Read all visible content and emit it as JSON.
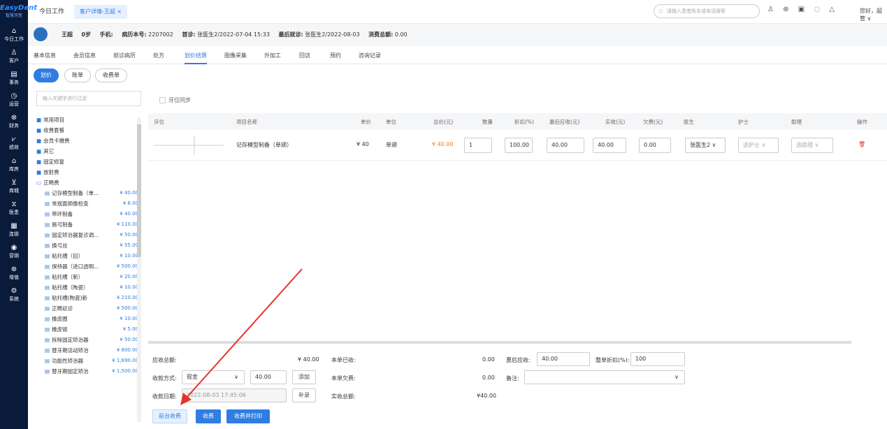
{
  "brand": {
    "name": "EasyDent",
    "sub": "智慧牙医"
  },
  "nav": [
    {
      "icon": "⌂",
      "label": "今日工作"
    },
    {
      "icon": "♙",
      "label": "客户"
    },
    {
      "icon": "▤",
      "label": "事务"
    },
    {
      "icon": "◷",
      "label": "运营"
    },
    {
      "icon": "⊗",
      "label": "财务"
    },
    {
      "icon": "⩗",
      "label": "绩效"
    },
    {
      "icon": "⌂",
      "label": "库房"
    },
    {
      "icon": "⊻",
      "label": "商城"
    },
    {
      "icon": "⧖",
      "label": "医患"
    },
    {
      "icon": "▦",
      "label": "连锁"
    },
    {
      "icon": "◉",
      "label": "营销"
    },
    {
      "icon": "⊕",
      "label": "增值"
    },
    {
      "icon": "⚙",
      "label": "系统"
    }
  ],
  "topbar": {
    "tab_today": "今日工作",
    "tab_active": "客户详情-王超 ×",
    "search_placeholder": "请输入患者姓名或电话搜索",
    "greeting": "您好，超管 ∨"
  },
  "patient": {
    "name": "王超",
    "age": "0岁",
    "phone_label": "手机:",
    "record_label": "病历本号:",
    "record_value": "2207002",
    "first_label": "首诊:",
    "first_value": "张医生2/2022-07-04 15:33",
    "last_label": "最后就诊:",
    "last_value": "张医生2/2022-08-03",
    "total_label": "消费总额:",
    "total_value": "0.00"
  },
  "tabs": [
    "基本信息",
    "会员信息",
    "就诊病历",
    "处方",
    "划价结算",
    "图像采集",
    "外加工",
    "回访",
    "预约",
    "咨询记录"
  ],
  "sub_tabs": [
    "划价",
    "账单",
    "收费单"
  ],
  "filter_placeholder": "输入关键字进行过滤",
  "tree": [
    {
      "label": "常用项目",
      "folder": true
    },
    {
      "label": "收费套餐",
      "folder": true
    },
    {
      "label": "会员卡缴费",
      "folder": true
    },
    {
      "label": "其它",
      "folder": true
    },
    {
      "label": "固定修复",
      "folder": true
    },
    {
      "label": "放射费",
      "folder": true
    },
    {
      "label": "正畸费",
      "folder": true,
      "open": true
    },
    {
      "label": "记存模型制备（单...",
      "price": "¥ 40.00"
    },
    {
      "label": "常规面颌像检查",
      "price": "¥ 8.00"
    },
    {
      "label": "带环制备",
      "price": "¥ 40.00"
    },
    {
      "label": "唇弓制备",
      "price": "¥ 110.00"
    },
    {
      "label": "固定矫治器复诊调...",
      "price": "¥ 50.00"
    },
    {
      "label": "换弓丝",
      "price": "¥ 55.00"
    },
    {
      "label": "粘托槽（旧）",
      "price": "¥ 10.00"
    },
    {
      "label": "保持器（进口透明...",
      "price": "¥ 500.00"
    },
    {
      "label": "粘托槽（新）",
      "price": "¥ 20.00"
    },
    {
      "label": "粘托槽（陶瓷）",
      "price": "¥ 10.00"
    },
    {
      "label": "粘托槽(陶瓷)新",
      "price": "¥ 210.00"
    },
    {
      "label": "正畸初诊",
      "price": "¥ 500.00"
    },
    {
      "label": "橡皮圈",
      "price": "¥ 10.00"
    },
    {
      "label": "橡皮链",
      "price": "¥ 5.00"
    },
    {
      "label": "拆除固定矫治器",
      "price": "¥ 50.00"
    },
    {
      "label": "替牙期活动矫治",
      "price": "¥ 800.00"
    },
    {
      "label": "功能性矫治器",
      "price": "¥ 1,690.00"
    },
    {
      "label": "替牙期固定矫治",
      "price": "¥ 1,500.00"
    }
  ],
  "sync_label": "牙位同步",
  "grid": {
    "headers": [
      "牙位",
      "项目名称",
      "单价",
      "单位",
      "总价(元)",
      "数量",
      "折扣(%)",
      "惠后应收(元)",
      "实收(元)",
      "欠费(元)",
      "医生",
      "护士",
      "助理",
      "操作"
    ],
    "row": {
      "name": "记存模型制备（单颌）",
      "price": "¥ 40",
      "unit": "单颌",
      "total": "¥ 40.00",
      "qty": "1",
      "discount": "100.00",
      "after": "40.00",
      "paid": "40.00",
      "owe": "0.00",
      "doctor": "张医生2",
      "nurse": "选护士",
      "assistant": "选助理",
      "delete_icon": "🗑"
    }
  },
  "footer": {
    "due_label": "应收总额:",
    "due_value": "¥ 40.00",
    "received_label": "本单已收:",
    "received_value": "0.00",
    "after_label": "惠后应收:",
    "after_value": "40.00",
    "discount_label": "整单折扣(%):",
    "discount_value": "100",
    "method_label": "收款方式:",
    "method_value": "现金",
    "method_amount": "40.00",
    "add_btn": "添加",
    "owe_label": "本单欠费:",
    "owe_value": "0.00",
    "note_label": "备注:",
    "date_label": "收款日期:",
    "date_value": "2022-08-03 17:45:06",
    "supp_btn": "补录",
    "actual_label": "实收总额:",
    "actual_value": "¥40.00",
    "btn_front": "前台收费",
    "btn_charge": "收费",
    "btn_charge_print": "收费并打印"
  },
  "colors": {
    "accent": "#2f7de1",
    "sidebar": "#0a1a3a",
    "annotation": "#e8332a"
  }
}
